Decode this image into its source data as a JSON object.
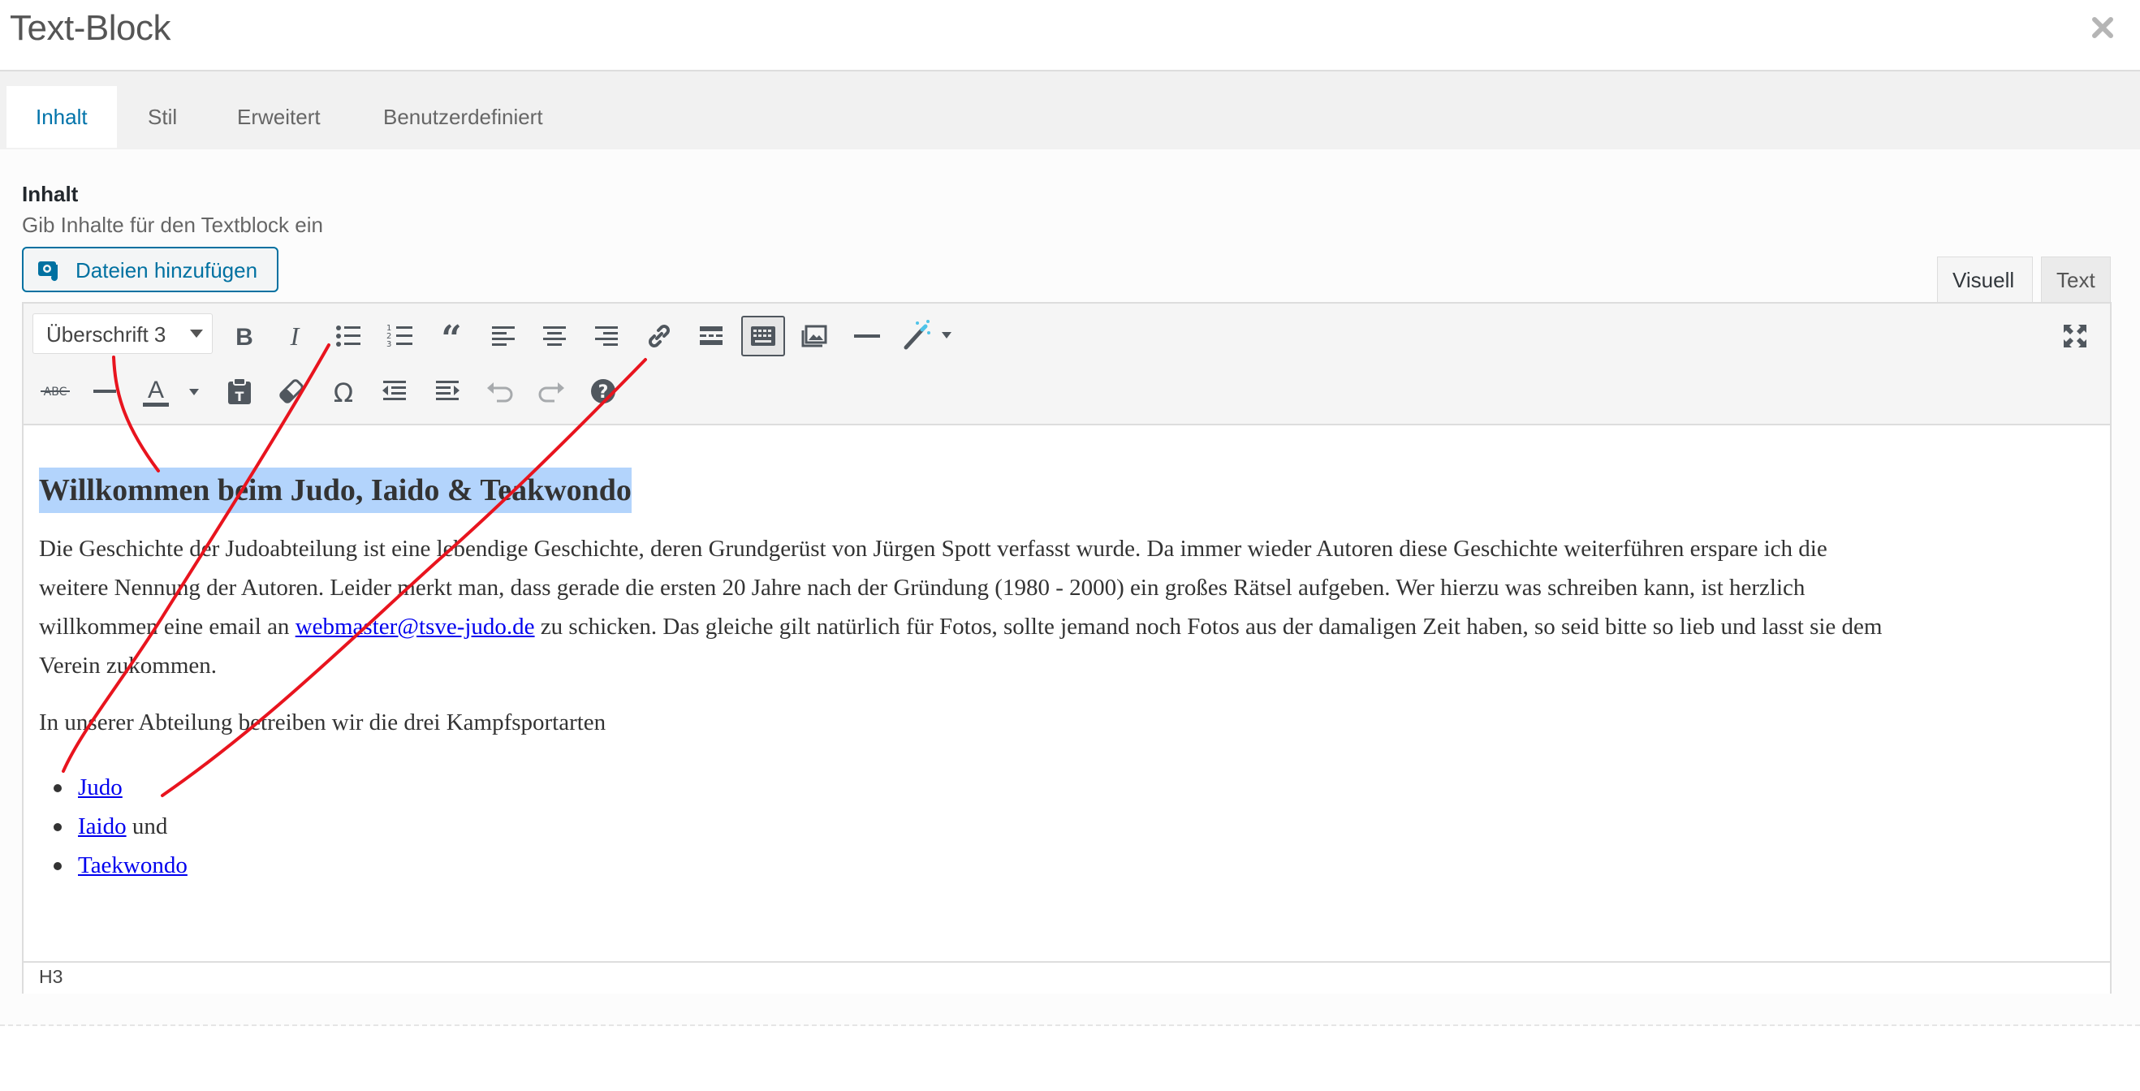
{
  "window": {
    "title": "Text-Block"
  },
  "tabs": [
    "Inhalt",
    "Stil",
    "Erweitert",
    "Benutzerdefiniert"
  ],
  "field": {
    "label": "Inhalt",
    "description": "Gib Inhalte für den Textblock ein",
    "add_files": "Dateien hinzufügen"
  },
  "editor_modes": {
    "visual": "Visuell",
    "text": "Text"
  },
  "toolbar": {
    "format": "Überschrift 3",
    "row1_icons": [
      "bold-icon",
      "italic-icon",
      "bulleted-list-icon",
      "numbered-list-icon",
      "blockquote-icon",
      "align-left-icon",
      "align-center-icon",
      "align-right-icon",
      "link-icon",
      "read-more-icon",
      "toolbar-toggle-icon",
      "gallery-icon",
      "horizontal-line-icon",
      "magic-wand-icon",
      "fullscreen-icon"
    ],
    "row2_icons": [
      "strikethrough-icon",
      "horizontal-rule-icon",
      "text-color-icon",
      "paste-as-text-icon",
      "clear-formatting-icon",
      "special-character-icon",
      "outdent-icon",
      "indent-icon",
      "undo-icon",
      "redo-icon",
      "help-icon"
    ],
    "strike_text": "ABC"
  },
  "document": {
    "heading": "Willkommen beim Judo, Iaido & Teakwondo",
    "p1_line1": "Die Geschichte der Judoabteilung ist eine lebendige Geschichte, deren Grundgerüst von Jürgen Spott verfasst wurde. Da immer wieder Autoren diese Geschichte weiterführen erspare ich die",
    "p1_line2": "weitere Nennung der Autoren. Leider merkt man, dass gerade die ersten 20 Jahre nach der Gründung (1980 - 2000) ein großes Rätsel aufgeben. Wer hierzu was schreiben kann, ist herzlich",
    "p1_line3_pre": "willkommen eine email an ",
    "p1_email": "webmaster@tsve-judo.de",
    "p1_line3_post": " zu schicken. Das gleiche gilt natürlich für Fotos, sollte jemand noch Fotos aus der damaligen Zeit haben, so seid bitte so lieb und lasst sie dem",
    "p1_line4": "Verein zukommen.",
    "p2": "In unserer Abteilung betreiben wir die drei Kampfsportarten",
    "list": [
      {
        "link": "Judo",
        "suffix": ""
      },
      {
        "link": "Iaido",
        "suffix": " und"
      },
      {
        "link": "Taekwondo",
        "suffix": ""
      }
    ]
  },
  "status_path": "H3",
  "colors": {
    "accent": "#0073aa",
    "selection": "#b3d4fc",
    "annotation": "#e8141e"
  }
}
